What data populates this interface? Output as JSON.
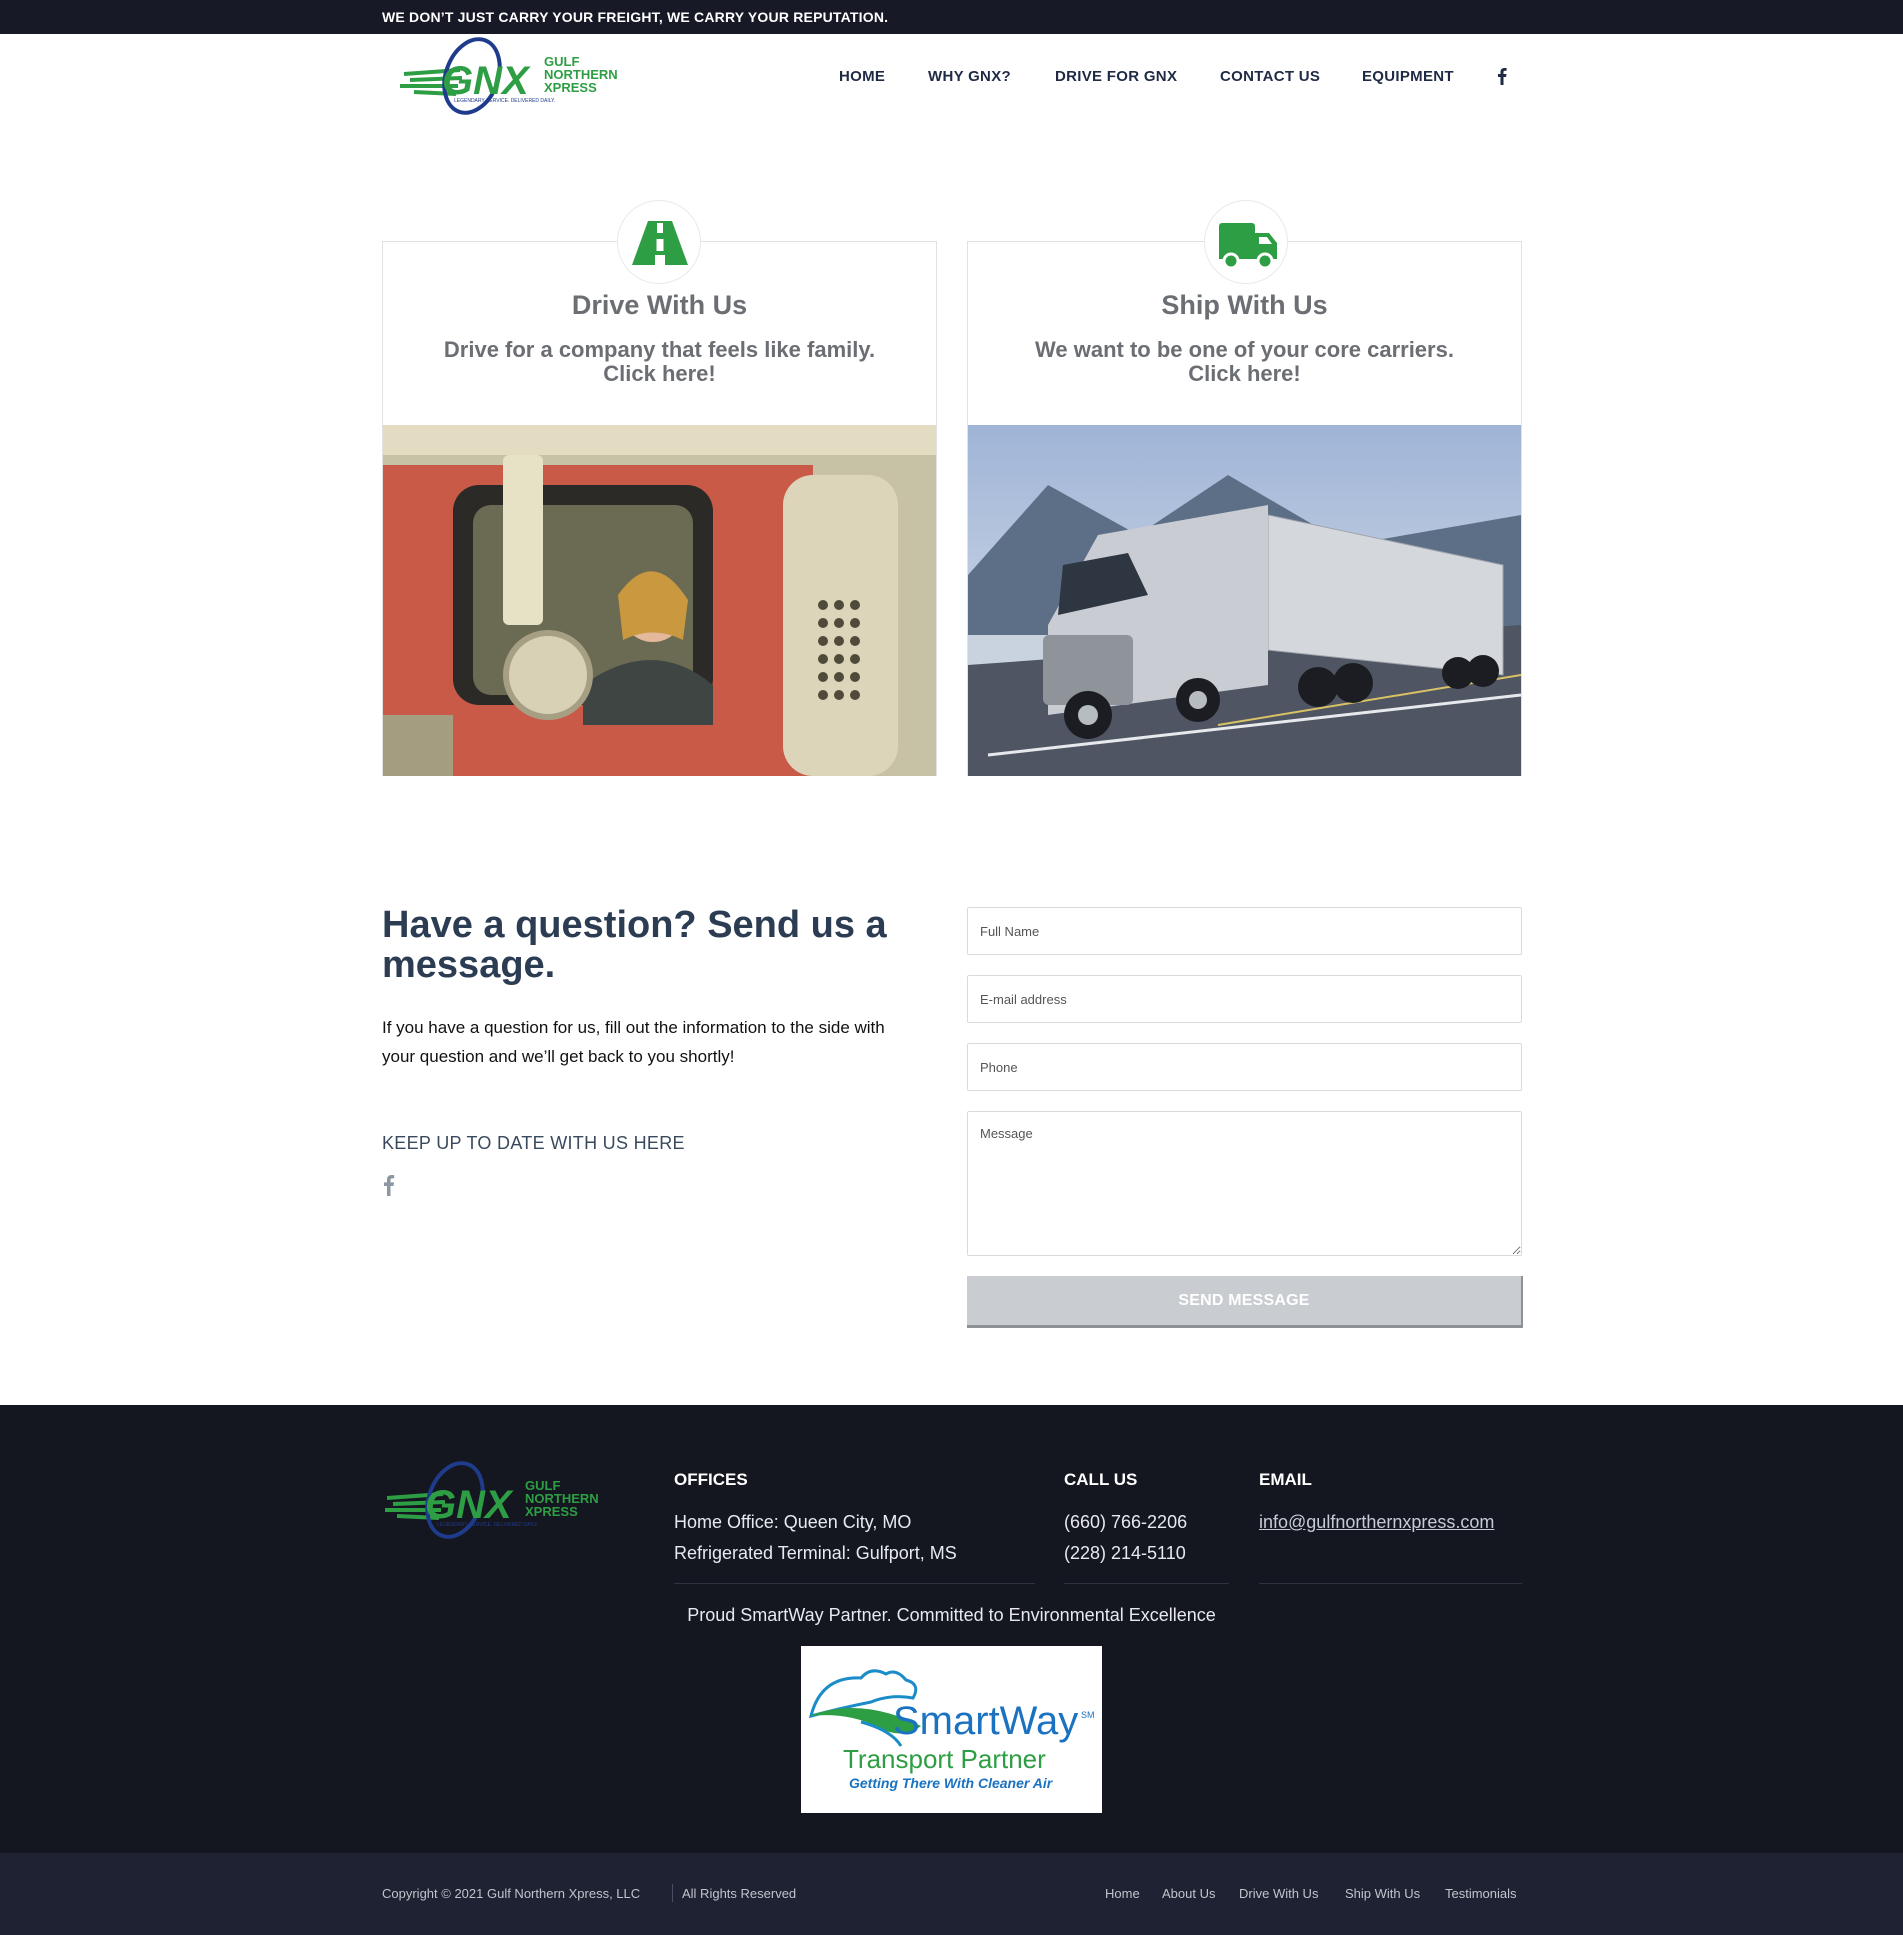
{
  "topbar": {
    "tagline": "WE DON’T JUST CARRY YOUR FREIGHT, WE CARRY YOUR REPUTATION."
  },
  "logo": {
    "gnx": "GNX",
    "line1": "GULF",
    "line2": "NORTHERN",
    "line3": "XPRESS",
    "tag": "LEGENDARY SERVICE. DELIVERED DAILY."
  },
  "nav": {
    "home": "HOME",
    "why": "WHY GNX?",
    "drive": "DRIVE FOR GNX",
    "contact": "CONTACT US",
    "equipment": "EQUIPMENT",
    "facebook_icon": "facebook-icon"
  },
  "cards": {
    "drive": {
      "title": "Drive With Us",
      "line1": "Drive for a company that feels like family.",
      "line2": "Click here!",
      "icon": "road-icon"
    },
    "ship": {
      "title": "Ship With Us",
      "line1": "We want to be one of your core carriers.",
      "line2": "Click here!",
      "icon": "truck-icon"
    }
  },
  "question": {
    "title": "Have a question? Send us a message.",
    "body": "If you have a question for us, fill out the information to the side with your question and we’ll get back to you shortly!",
    "keep": "KEEP UP TO DATE WITH US HERE"
  },
  "form": {
    "name_placeholder": "Full Name",
    "email_placeholder": "E-mail address",
    "phone_placeholder": "Phone",
    "message_placeholder": "Message",
    "send": "SEND MESSAGE"
  },
  "footer": {
    "offices_head": "OFFICES",
    "office1": "Home Office: Queen City, MO",
    "office2": "Refrigerated Terminal: Gulfport, MS",
    "call_head": "CALL US",
    "phone1": "(660) 766-2206",
    "phone2": "(228) 214-5110",
    "email_head": "EMAIL",
    "email": "info@gulfnorthernxpress.com",
    "smartway_note": "Proud SmartWay Partner. Committed to Environmental Excellence",
    "smartway_name": "SmartWay",
    "smartway_sm": "SM",
    "smartway_partner": "Transport Partner",
    "smartway_tag": "Getting There With Cleaner Air"
  },
  "bottom": {
    "copyright": "Copyright ©  2021  Gulf Northern Xpress, LLC",
    "rights": "All Rights Reserved",
    "links": [
      "Home",
      "About Us",
      "Drive With Us",
      "Ship With Us",
      "Testimonials"
    ]
  },
  "colors": {
    "brand_green": "#2e9e44",
    "brand_blue": "#1f3b8c",
    "dark": "#141720",
    "heading": "#2c3d53"
  }
}
